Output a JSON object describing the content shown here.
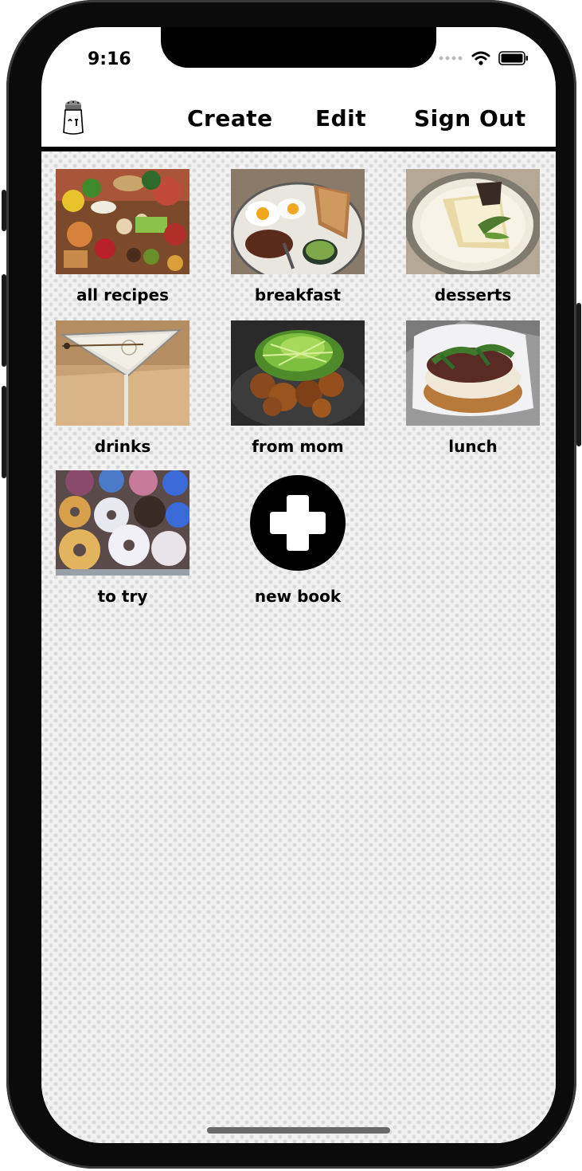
{
  "status_bar": {
    "time": "9:16"
  },
  "nav": {
    "create_label": "Create",
    "edit_label": "Edit",
    "sign_out_label": "Sign Out"
  },
  "books": [
    {
      "label": "all recipes",
      "image": "assorted-foods-photo"
    },
    {
      "label": "breakfast",
      "image": "breakfast-plate-photo"
    },
    {
      "label": "desserts",
      "image": "cheesecake-slice-photo"
    },
    {
      "label": "drinks",
      "image": "martini-glass-photo"
    },
    {
      "label": "from mom",
      "image": "fried-chicken-greens-photo"
    },
    {
      "label": "lunch",
      "image": "sandwich-photo"
    },
    {
      "label": "to try",
      "image": "donuts-photo"
    }
  ],
  "new_book": {
    "label": "new book",
    "icon": "plus-circle-icon"
  },
  "colors": {
    "text": "#000000",
    "background_pattern": "#f1f1f1"
  }
}
